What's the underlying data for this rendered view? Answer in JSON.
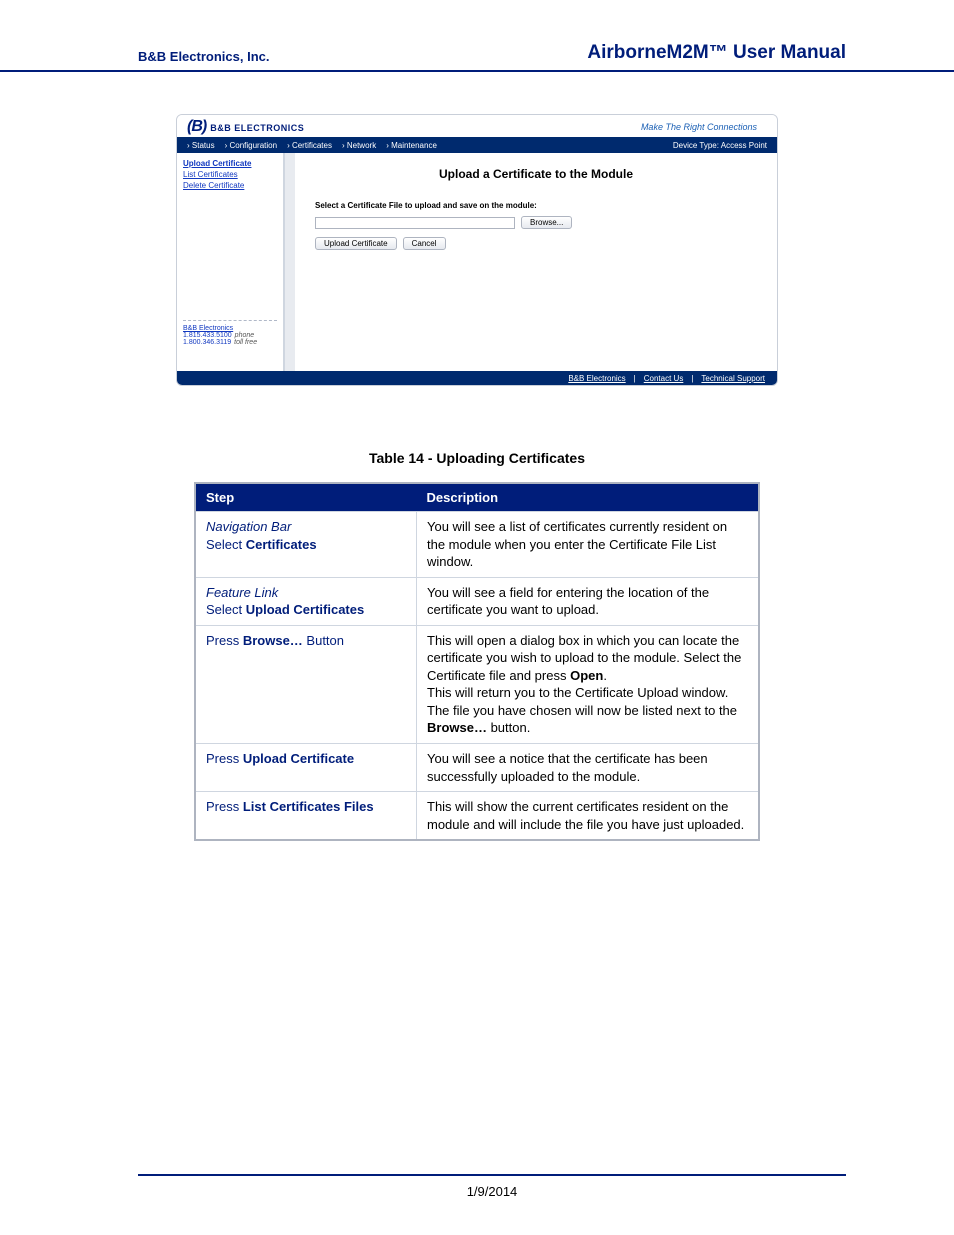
{
  "header": {
    "company": "B&B Electronics, Inc.",
    "title": "AirborneM2M™ User Manual"
  },
  "screenshot": {
    "logo": {
      "symbol": "(B)",
      "brand": "B&B ELECTRONICS"
    },
    "slogan": "Make The Right Connections",
    "nav": {
      "items": [
        "Status",
        "Configuration",
        "Certificates",
        "Network",
        "Maintenance"
      ],
      "device_type": "Device Type: Access Point"
    },
    "sidebar": {
      "links": [
        {
          "label": "Upload Certificate",
          "active": true
        },
        {
          "label": "List Certificates",
          "active": false
        },
        {
          "label": "Delete Certificate",
          "active": false
        }
      ],
      "contact": {
        "title": "B&B Electronics",
        "phone": "1.815.433.5100",
        "phone_lbl": "phone",
        "toll": "1.800.346.3119",
        "toll_lbl": "toll free"
      }
    },
    "main": {
      "heading": "Upload a Certificate to the Module",
      "instruction": "Select a Certificate File to upload and save on the module:",
      "file_input_value": "",
      "browse_button": "Browse...",
      "upload_button": "Upload Certificate",
      "cancel_button": "Cancel"
    },
    "footer": {
      "links": [
        "B&B Electronics",
        "Contact Us",
        "Technical Support"
      ]
    }
  },
  "table_caption": "Table 14 - Uploading Certificates",
  "table": {
    "headers": [
      "Step",
      "Description"
    ],
    "rows": [
      {
        "step_html": "<span class='italic'>Navigation Bar</span><br>Select <b>Certificates</b>",
        "desc_html": "You will see a list of certificates currently resident on the module when you enter the Certificate File List window."
      },
      {
        "step_html": "<span class='italic'>Feature Link</span><br>Select <b>Upload Certificates</b>",
        "desc_html": "You will see a field for entering the location of the certificate you want to upload."
      },
      {
        "step_html": "Press <b>Browse…</b> Button",
        "desc_html": "This will open a dialog box in which you can locate the certificate you wish to upload to the module. Select the Certificate file and press <b>Open</b>.<br>This will return you to the Certificate Upload window.  The file you have chosen will now be listed next to the <b>Browse…</b> button."
      },
      {
        "step_html": "Press <b>Upload Certificate</b>",
        "desc_html": "You will see a notice that the certificate has been successfully uploaded to the module."
      },
      {
        "step_html": "Press <b>List Certificates Files</b>",
        "desc_html": "This will show the current certificates resident on the module and will include the file you have just uploaded."
      }
    ]
  },
  "footer_date": "1/9/2014"
}
